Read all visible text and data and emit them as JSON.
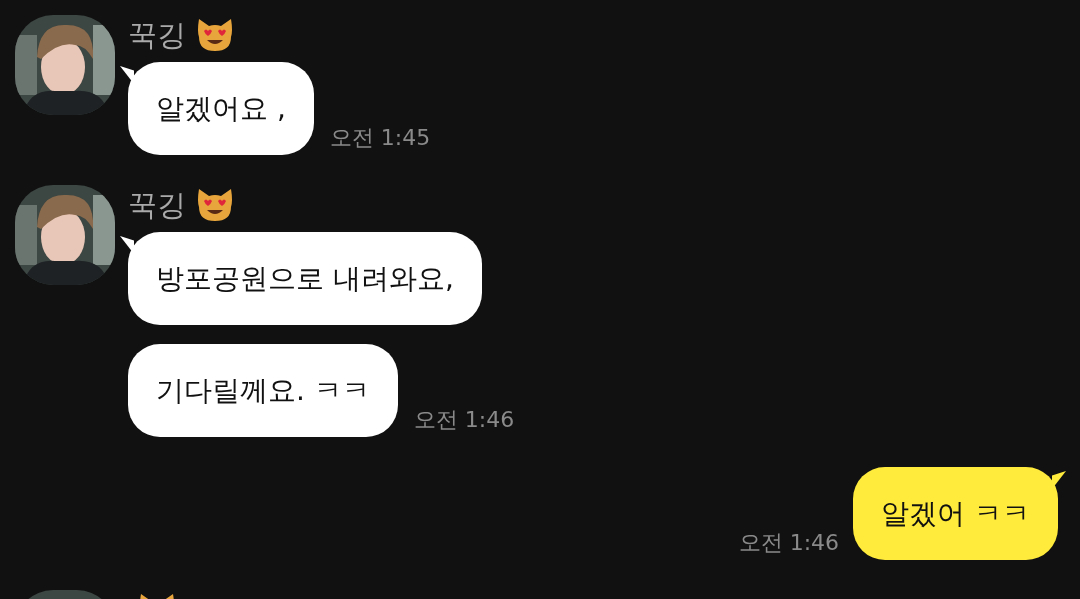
{
  "groups": [
    {
      "kind": "received",
      "name": "꾹깅",
      "messages": [
        "알겠어요 ,"
      ],
      "time": "오전 1:45"
    },
    {
      "kind": "received",
      "name": "꾹깅",
      "messages": [
        "방포공원으로 내려와요,",
        "기다릴께요. ㅋㅋ"
      ],
      "time": "오전 1:46"
    },
    {
      "kind": "sent",
      "messages": [
        "알겠어 ㅋㅋ"
      ],
      "time": "오전 1:46"
    },
    {
      "kind": "received"
    }
  ]
}
